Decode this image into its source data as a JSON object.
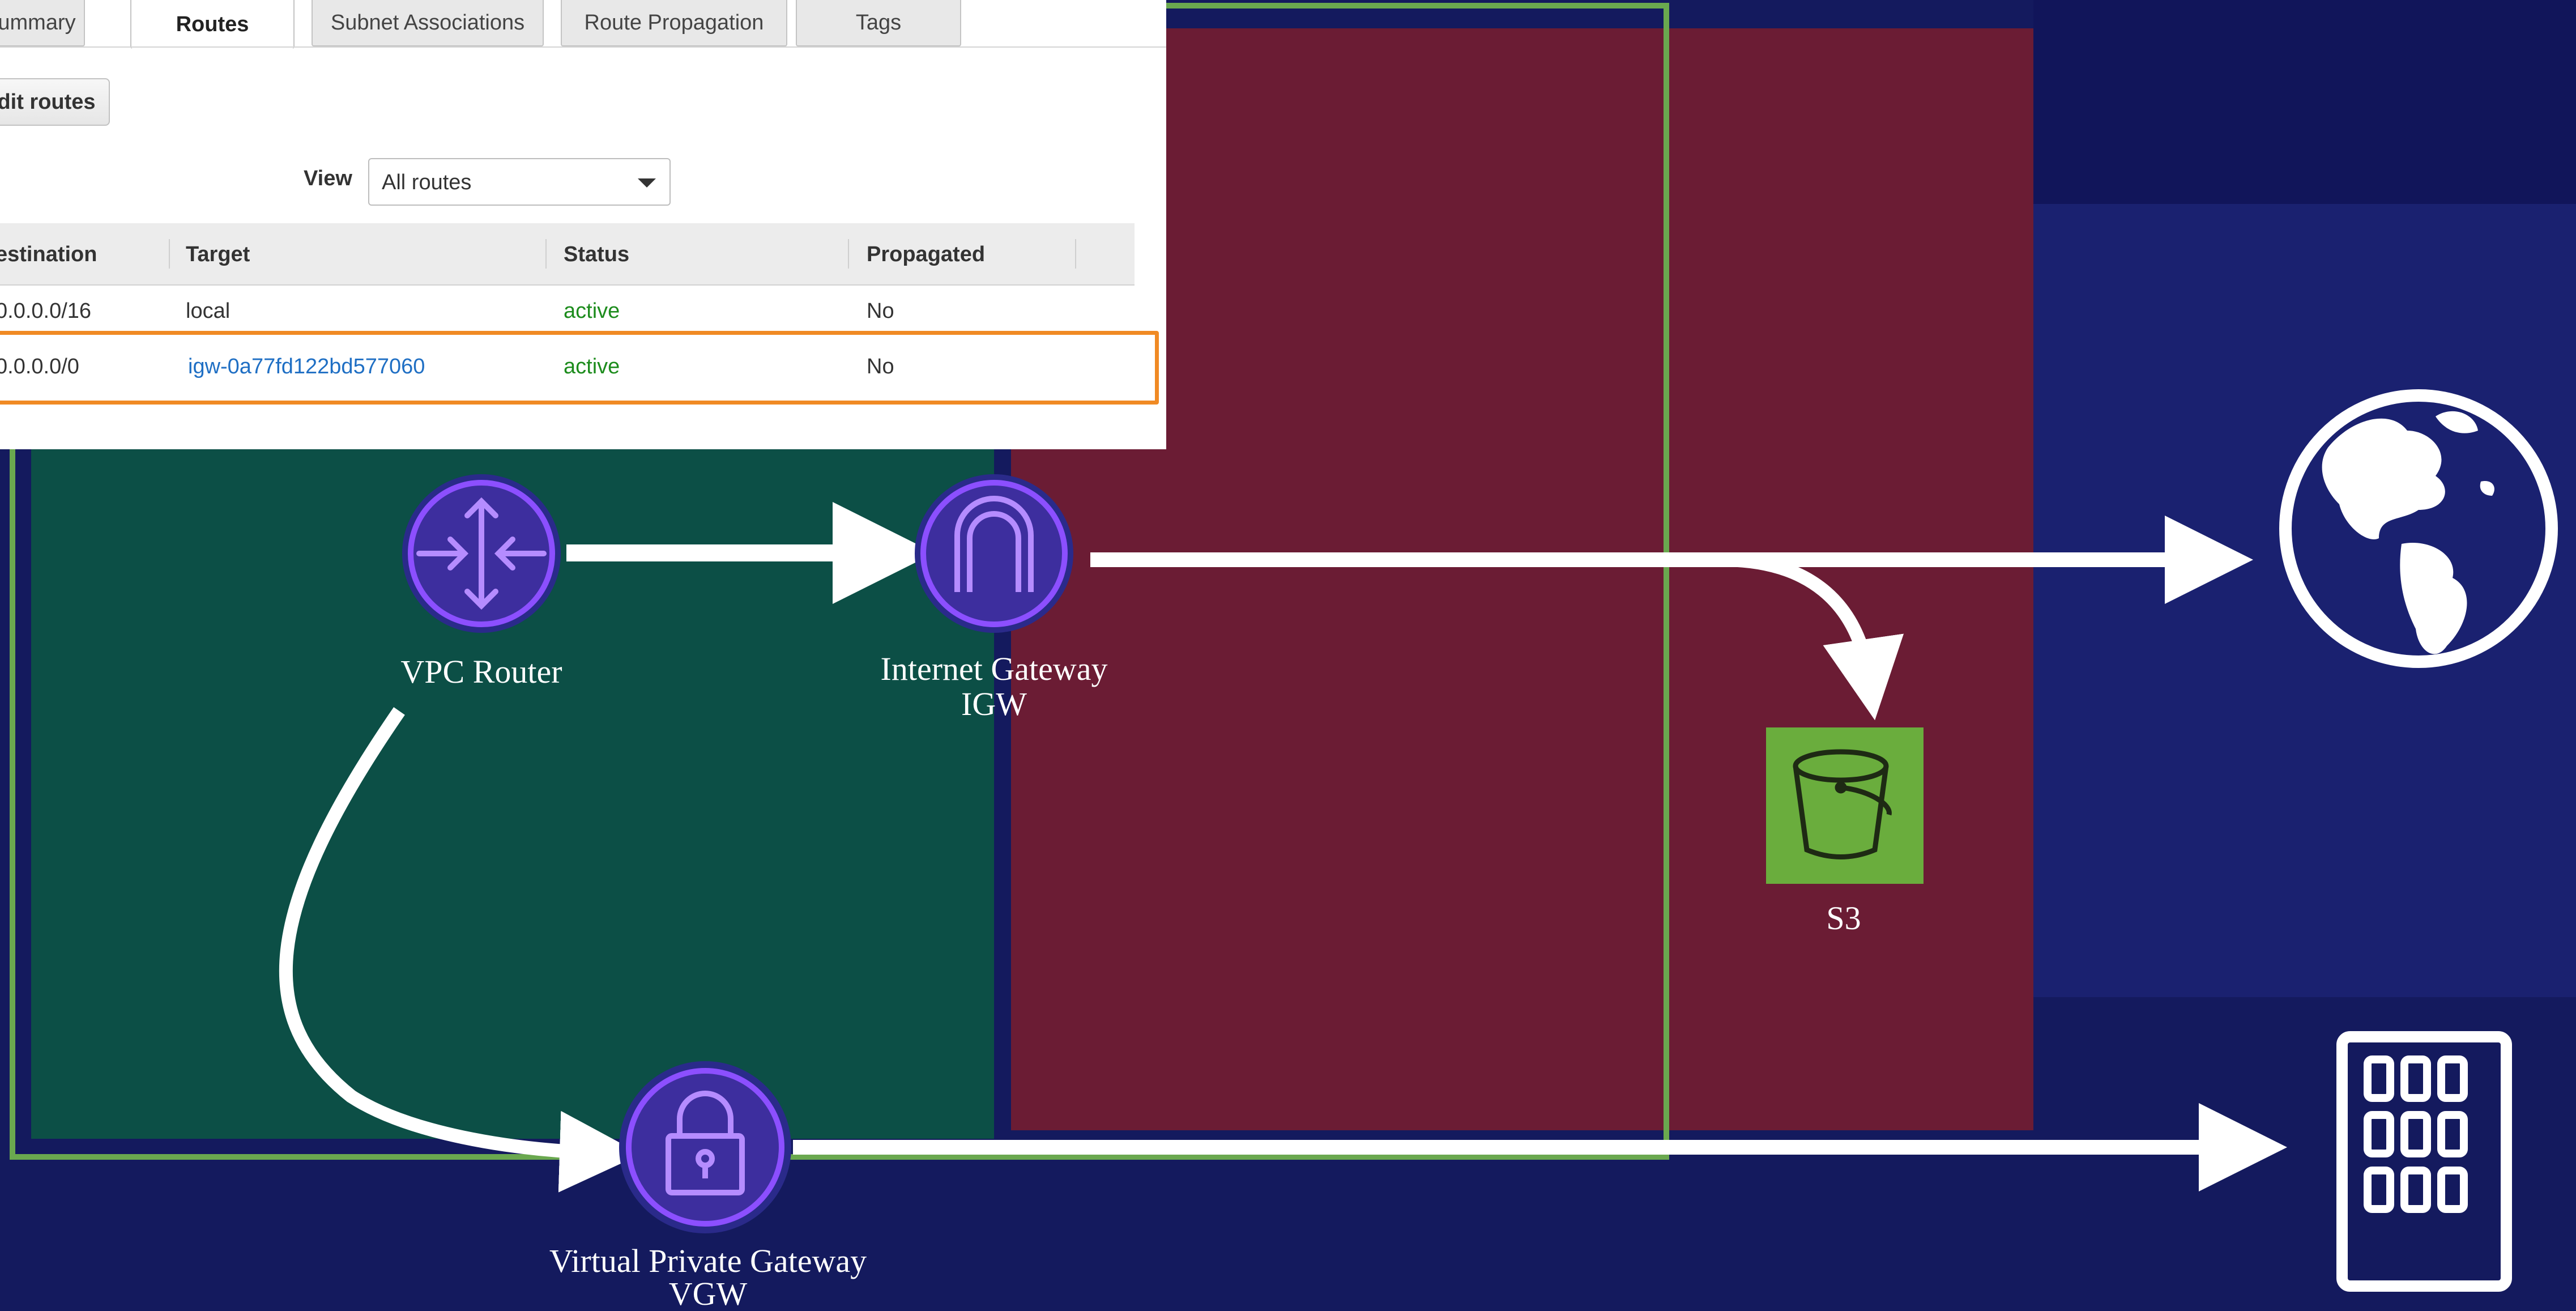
{
  "route_table": {
    "tabs": [
      {
        "label": "ummary",
        "active": false
      },
      {
        "label": "Routes",
        "active": true
      },
      {
        "label": "Subnet Associations",
        "active": false
      },
      {
        "label": "Route Propagation",
        "active": false
      },
      {
        "label": "Tags",
        "active": false
      }
    ],
    "edit_button": "dit routes",
    "view_label": "View",
    "view_select": "All routes",
    "columns": [
      "estination",
      "Target",
      "Status",
      "Propagated"
    ],
    "rows": [
      {
        "destination": "0.0.0.0/16",
        "target": "local",
        "status": "active",
        "propagated": "No",
        "highlighted": false
      },
      {
        "destination": "0.0.0.0/0",
        "target": "igw-0a77fd122bd577060",
        "status": "active",
        "propagated": "No",
        "highlighted": true
      }
    ]
  },
  "diagram": {
    "nodes": {
      "vpc_router": {
        "label": "VPC Router",
        "icon": "router-icon"
      },
      "internet_gateway": {
        "label_line1": "Internet Gateway",
        "label_line2": "IGW",
        "icon": "internet-gateway-icon"
      },
      "s3": {
        "label": "S3",
        "icon": "bucket-icon"
      },
      "vgw": {
        "label_line1": "Virtual Private Gateway",
        "label_line2": "VGW",
        "icon": "lock-icon"
      },
      "internet": {
        "icon": "globe-icon"
      },
      "datacenter": {
        "icon": "building-icon"
      }
    },
    "colors": {
      "background": "#141a5e",
      "private_subnet": "#0c4f46",
      "public_subnet": "#6b1c34",
      "vpc_border": "#6aa84f",
      "highlight": "#f08a24",
      "node_purple": "#8c4fff",
      "s3_green": "#6aad3d"
    }
  }
}
